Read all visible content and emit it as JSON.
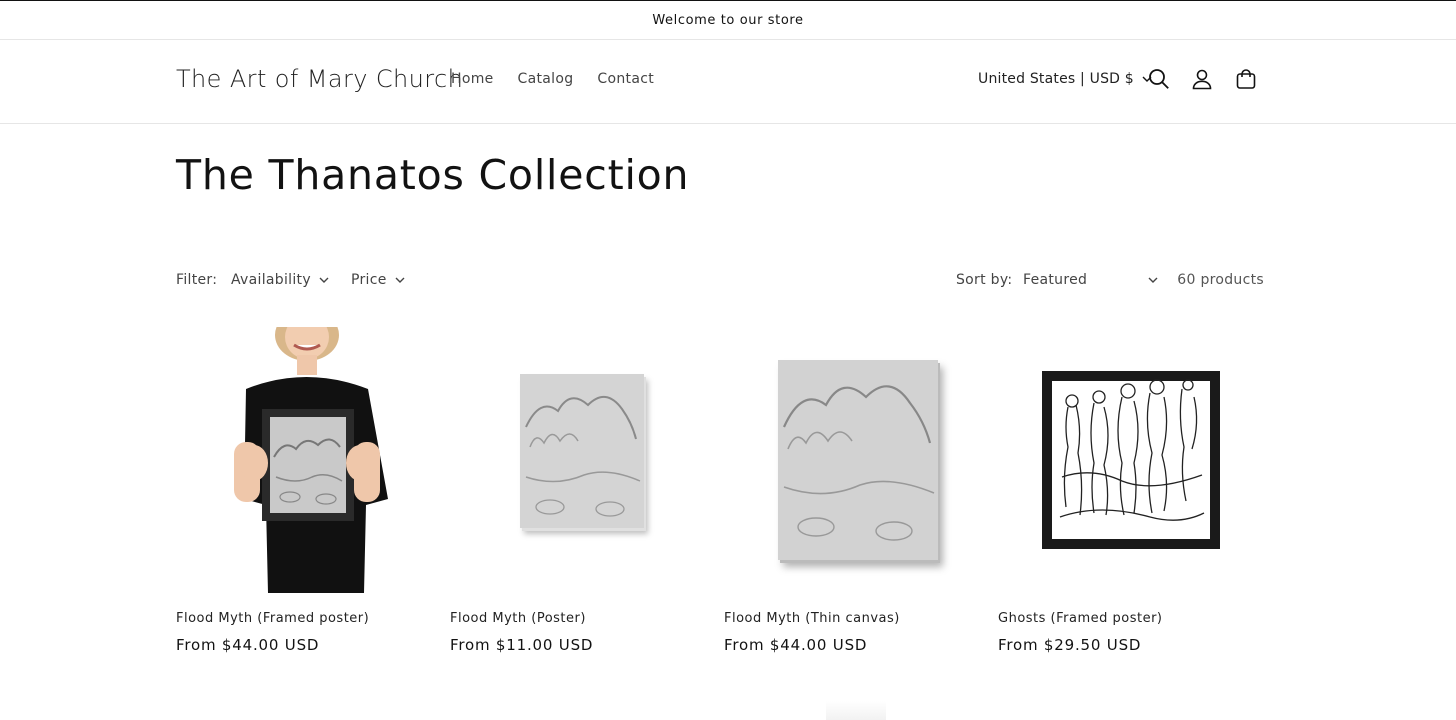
{
  "announcement": "Welcome to our store",
  "header": {
    "logo": "The Art of Mary Church",
    "nav": [
      "Home",
      "Catalog",
      "Contact"
    ],
    "country": "United States | USD $",
    "icons": [
      "search-icon",
      "account-icon",
      "cart-icon"
    ]
  },
  "collection": {
    "title": "The Thanatos Collection"
  },
  "filters": {
    "label": "Filter:",
    "availability": "Availability",
    "price": "Price",
    "sort_label": "Sort by:",
    "sort_value": "Featured",
    "count": "60 products"
  },
  "products": [
    {
      "title": "Flood Myth (Framed poster)",
      "price": "From $44.00 USD"
    },
    {
      "title": "Flood Myth (Poster)",
      "price": "From $11.00 USD"
    },
    {
      "title": "Flood Myth (Thin canvas)",
      "price": "From $44.00 USD"
    },
    {
      "title": "Ghosts (Framed poster)",
      "price": "From $29.50 USD"
    }
  ],
  "colors": {
    "text": "#121212",
    "border": "#e6e6e6",
    "frame": "#1a1a1a"
  }
}
